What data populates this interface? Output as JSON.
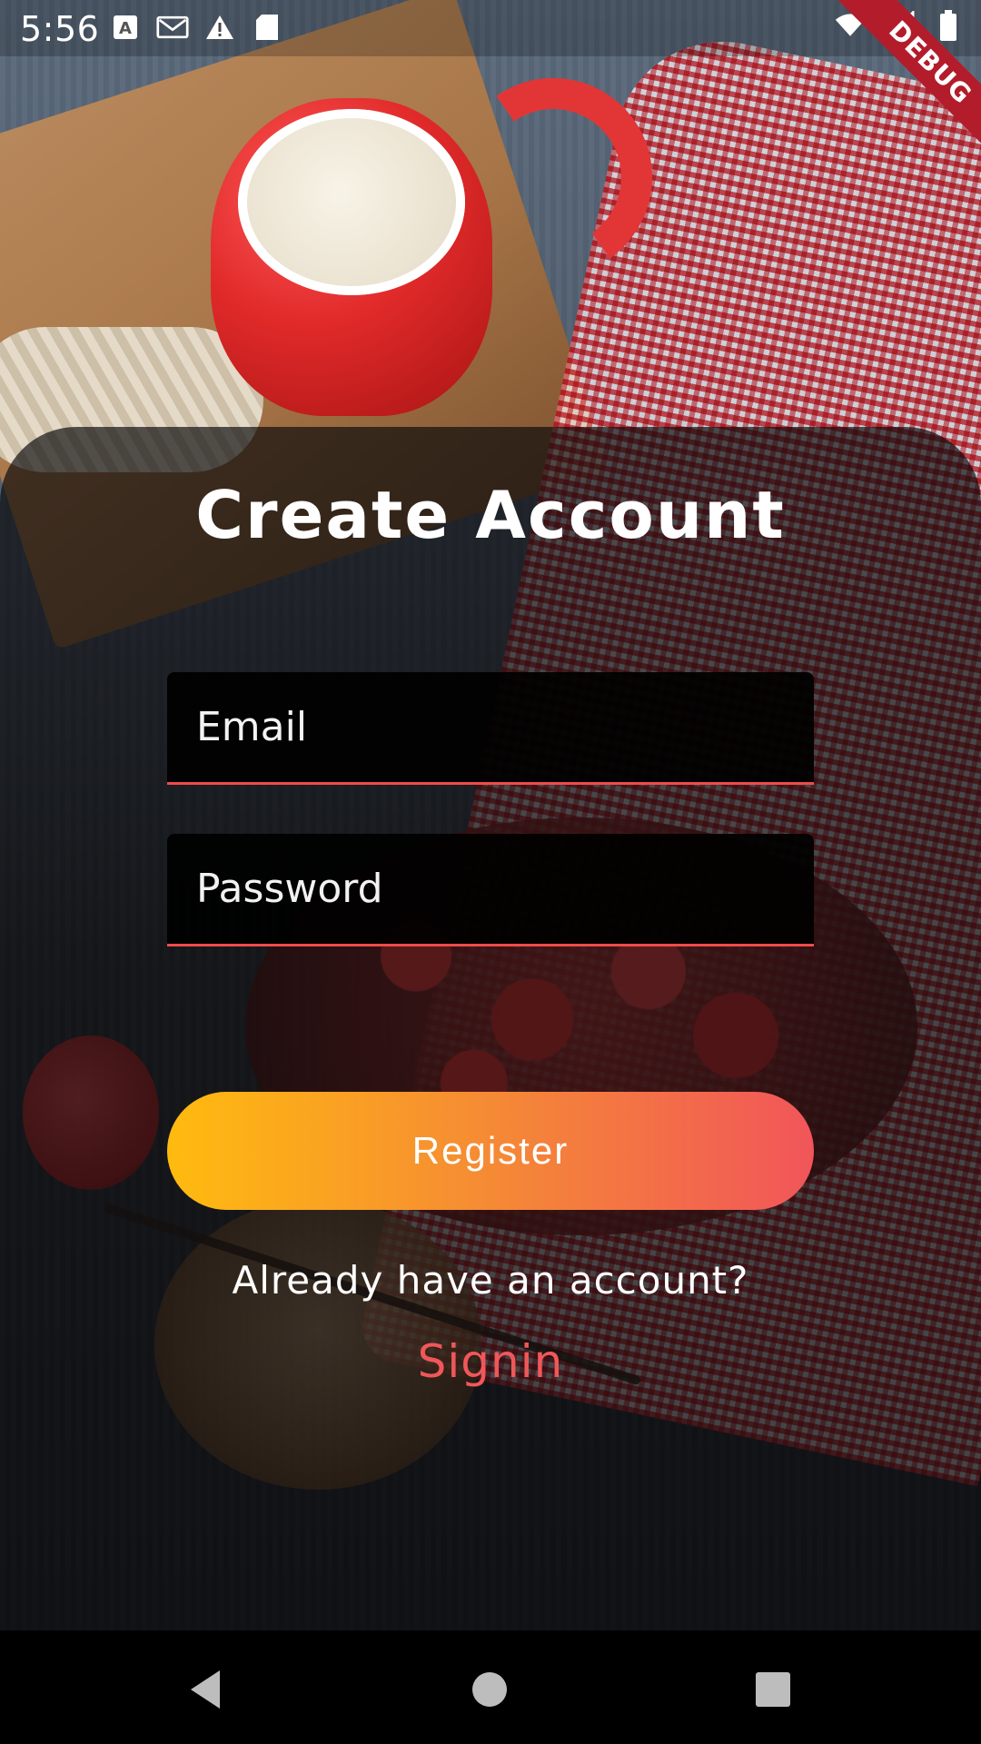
{
  "status_bar": {
    "time": "5:56",
    "left_icons": [
      "font-a-icon",
      "gmail-icon",
      "warning-icon",
      "sd-card-icon"
    ],
    "right_icons": [
      "wifi-icon",
      "signal-icon",
      "battery-icon"
    ],
    "debug_label": "DEBUG"
  },
  "form": {
    "title": "Create Account",
    "email_placeholder": "Email",
    "password_placeholder": "Password",
    "register_label": "Register",
    "prompt_text": "Already have an account?",
    "signin_link": "Signin"
  },
  "colors": {
    "accent": "#f04b4b",
    "gradient_start": "#ffbb0f",
    "gradient_end": "#f1555a",
    "panel_overlay": "#0a0a0c"
  },
  "nav_bar": {
    "icons": [
      "back-icon",
      "home-icon",
      "recents-icon"
    ]
  }
}
